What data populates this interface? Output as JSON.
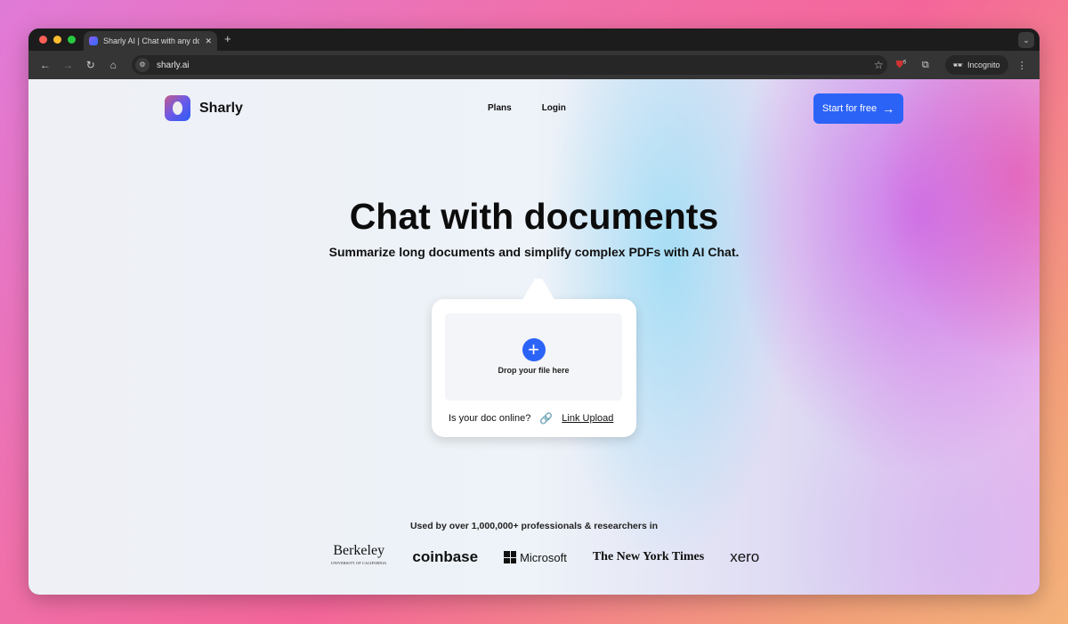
{
  "browser": {
    "tab_title": "Sharly AI | Chat with any docu",
    "url": "sharly.ai",
    "incognito_label": "Incognito",
    "extension_badge": "6"
  },
  "header": {
    "brand": "Sharly",
    "nav": [
      "Plans",
      "Login"
    ],
    "cta": "Start for free"
  },
  "hero": {
    "title": "Chat with documents",
    "subtitle": "Summarize long documents and simplify complex PDFs with AI Chat."
  },
  "upload": {
    "drop_label": "Drop your file here",
    "online_question": "Is your doc online?",
    "link_upload": "Link Upload"
  },
  "social": {
    "used_by": "Used by over 1,000,000+ professionals & researchers in",
    "logos": [
      "Berkeley",
      "coinbase",
      "Microsoft",
      "The New York Times",
      "xero"
    ],
    "berkeley_sub": "UNIVERSITY OF CALIFORNIA"
  },
  "colors": {
    "accent": "#2c63f7",
    "link_icon": "#9c5cf0"
  }
}
